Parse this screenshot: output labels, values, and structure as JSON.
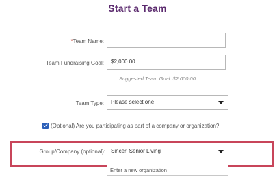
{
  "page_title": "Start a Team",
  "form": {
    "team_name": {
      "required_marker": "*",
      "label": "Team Name:",
      "value": ""
    },
    "fundraising_goal": {
      "label": "Team Fundraising Goal:",
      "value": "$2,000.00",
      "hint": "Suggested Team Goal: $2,000.00"
    },
    "team_type": {
      "label": "Team Type:",
      "selected": "Please select one"
    },
    "company_checkbox": {
      "checked": true,
      "label": "(Optional) Are you participating as part of a company or organization?"
    },
    "group_company": {
      "label": "Group/Company (optional):",
      "selected": "Sinceri Senior Living",
      "options": [
        "Enter a new organization"
      ]
    }
  },
  "colors": {
    "title": "#5b2a6e",
    "highlight_border": "#c8455a",
    "checkbox": "#2b5fb8",
    "required": "#c0392b"
  }
}
